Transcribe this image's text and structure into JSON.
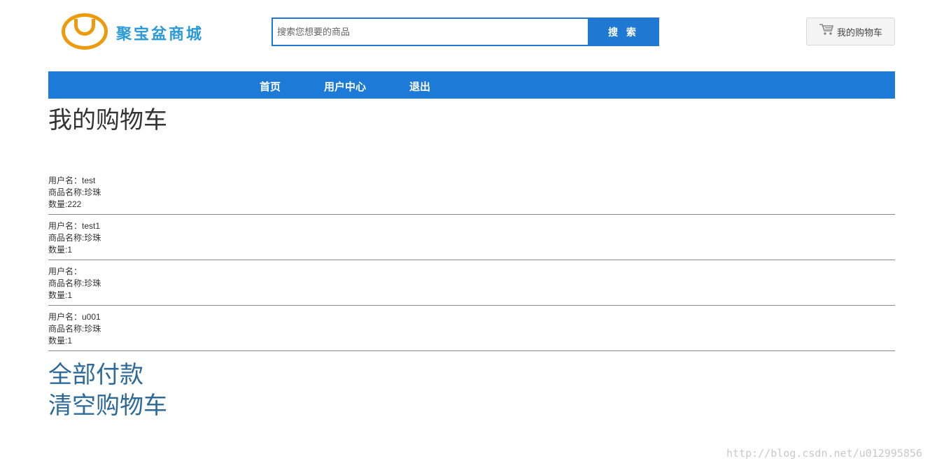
{
  "header": {
    "logo_text": "聚宝盆商城",
    "search_placeholder": "搜索您想要的商品",
    "search_button": "搜 索",
    "cart_button": "我的购物车"
  },
  "nav": {
    "items": [
      {
        "label": "首页"
      },
      {
        "label": "用户中心"
      },
      {
        "label": "退出"
      }
    ]
  },
  "page_title": "我的购物车",
  "cart": {
    "items": [
      {
        "user": "用户名：test",
        "product": "商品名称:珍珠",
        "qty": "数量:222"
      },
      {
        "user": "用户名：test1",
        "product": "商品名称:珍珠",
        "qty": "数量:1"
      },
      {
        "user": "用户名：",
        "product": "商品名称:珍珠",
        "qty": "数量:1"
      },
      {
        "user": "用户名：u001",
        "product": "商品名称:珍珠",
        "qty": "数量:1"
      }
    ]
  },
  "actions": {
    "pay_all": "全部付款",
    "clear_cart": "清空购物车"
  },
  "watermark": "http://blog.csdn.net/u012995856",
  "colors": {
    "brand_blue": "#1e7ad7",
    "logo_orange": "#ec9b0d",
    "link": "#2d6a9a"
  }
}
